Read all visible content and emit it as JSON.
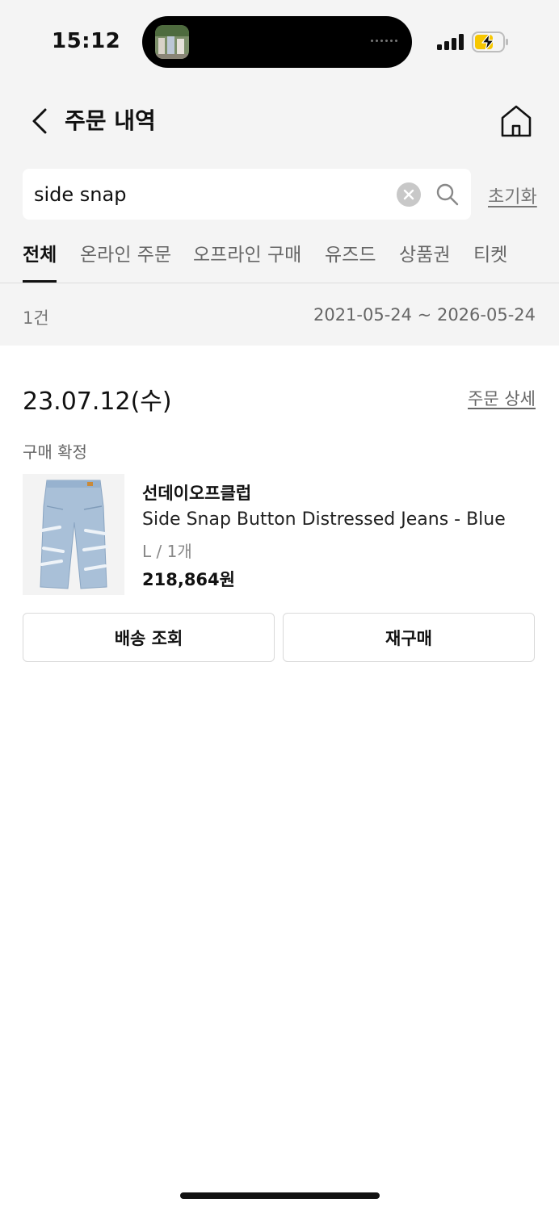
{
  "status_bar": {
    "time": "15:12"
  },
  "header": {
    "title": "주문 내역"
  },
  "search": {
    "value": "side snap",
    "reset_label": "초기화"
  },
  "tabs": [
    {
      "label": "전체",
      "active": true
    },
    {
      "label": "온라인 주문"
    },
    {
      "label": "오프라인 구매"
    },
    {
      "label": "유즈드"
    },
    {
      "label": "상품권"
    },
    {
      "label": "티켓"
    }
  ],
  "summary": {
    "count": "1건",
    "range": "2021-05-24 ~ 2026-05-24"
  },
  "order": {
    "date": "23.07.12(수)",
    "detail_label": "주문 상세",
    "status": "구매 확정",
    "item": {
      "brand": "선데이오프클럽",
      "name": "Side Snap Button Distressed Jeans - Blue",
      "option": "L / 1개",
      "price": "218,864원"
    },
    "buttons": {
      "track": "배송 조회",
      "rebuy": "재구매"
    }
  },
  "colors": {
    "accent": "#111111",
    "background_top": "#f4f4f4",
    "battery_charging": "#f7c700"
  },
  "icons": [
    "back-icon",
    "home-icon",
    "clear-icon",
    "search-icon",
    "signal-icon",
    "battery-charging-icon"
  ]
}
